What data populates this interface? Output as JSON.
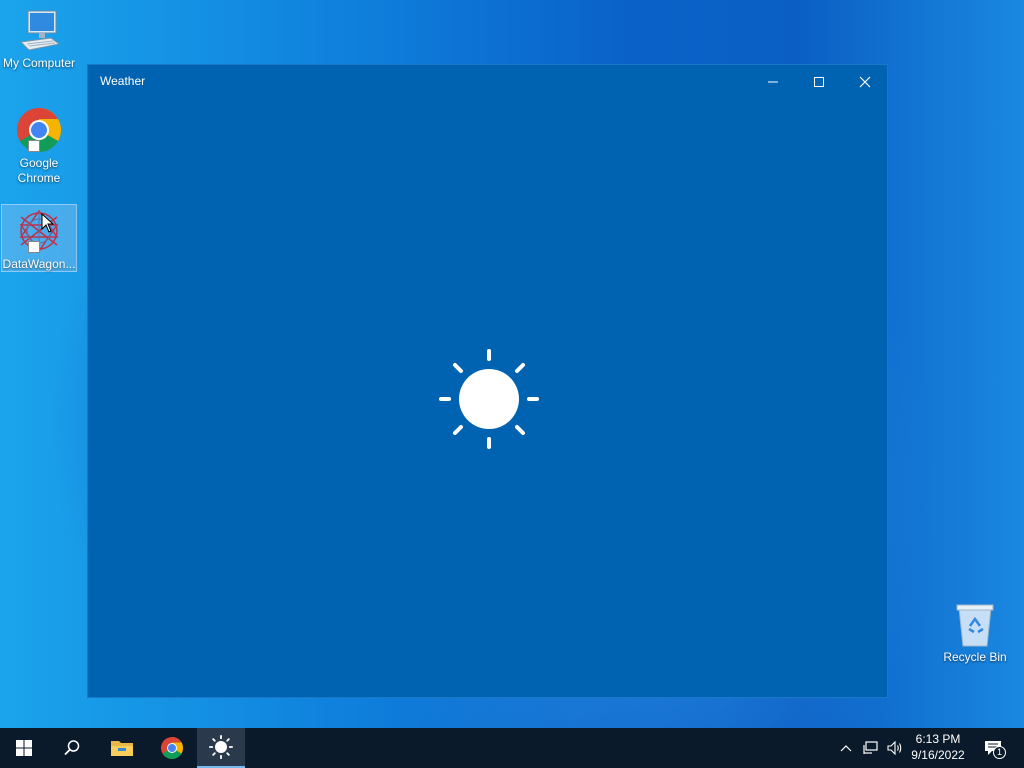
{
  "desktop": {
    "icons": [
      {
        "label": "My Computer"
      },
      {
        "label": "Google Chrome"
      },
      {
        "label": "DataWagon..."
      },
      {
        "label": "Recycle Bin"
      }
    ]
  },
  "window": {
    "title": "Weather",
    "content_icon": "sun-icon"
  },
  "taskbar": {
    "items": [
      "start-icon",
      "search-icon",
      "file-explorer-icon",
      "chrome-icon",
      "weather-icon"
    ],
    "active_item": "weather-icon",
    "tray": {
      "time": "6:13 PM",
      "date": "9/16/2022",
      "notification_count": "1"
    }
  },
  "colors": {
    "window_bg": "#0063b1",
    "taskbar_bg": "#0b1a2a"
  }
}
